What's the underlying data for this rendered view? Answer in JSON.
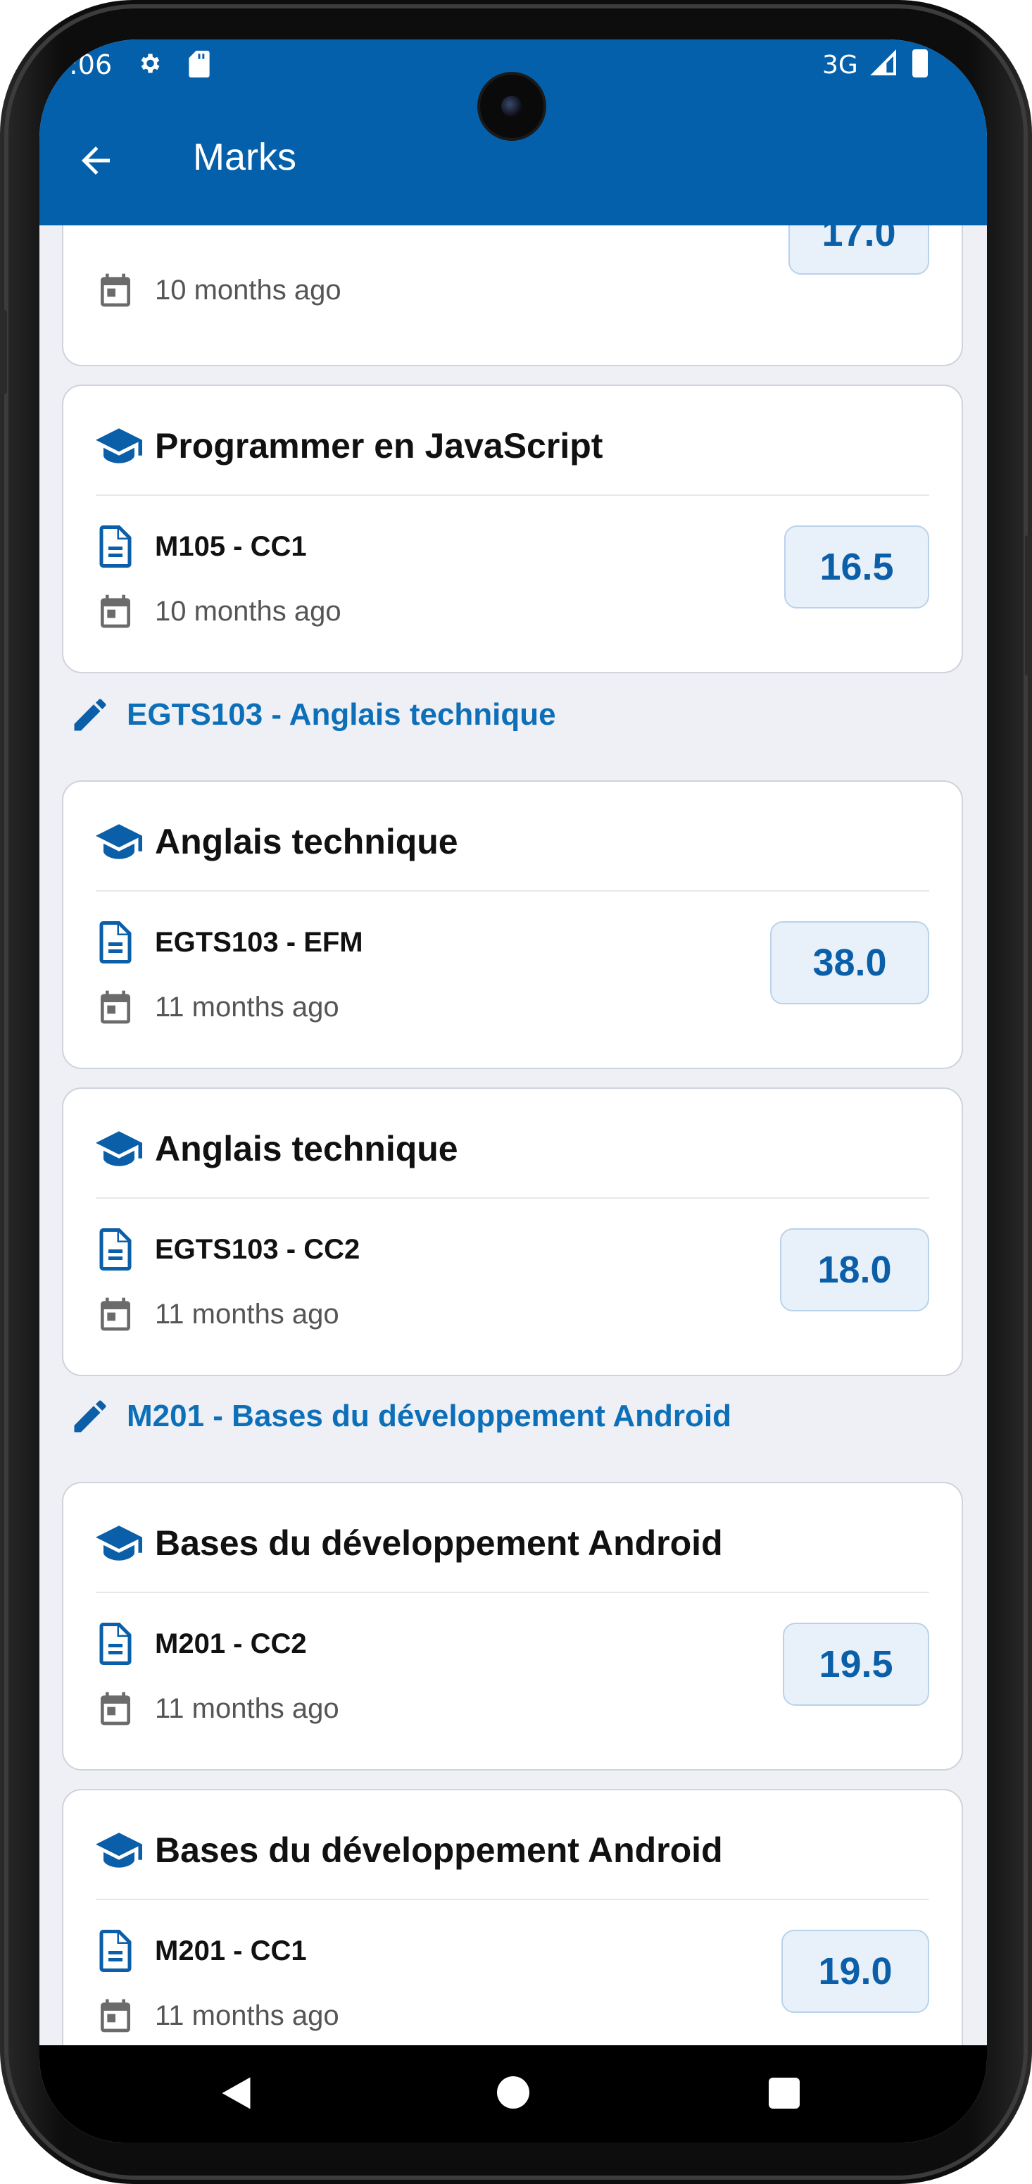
{
  "status_bar": {
    "time": ":06",
    "network": "3G"
  },
  "app_bar": {
    "title": "Marks"
  },
  "colors": {
    "primary": "#0460aa",
    "section_title": "#0d6fb8",
    "mark_text": "#0b5ea8",
    "mark_bg": "#e8f1fa"
  },
  "partial_card": {
    "date": "10 months ago",
    "mark": "17.0"
  },
  "sections": [
    {
      "title": null,
      "cards": [
        {
          "course": "Programmer en JavaScript",
          "exam": "M105 - CC1",
          "date": "10 months ago",
          "mark": "16.5"
        }
      ]
    },
    {
      "title": "EGTS103 - Anglais technique",
      "cards": [
        {
          "course": "Anglais technique",
          "exam": "EGTS103 - EFM",
          "date": "11 months ago",
          "mark": "38.0"
        },
        {
          "course": "Anglais technique",
          "exam": "EGTS103 - CC2",
          "date": "11 months ago",
          "mark": "18.0"
        }
      ]
    },
    {
      "title": "M201 - Bases du développement Android",
      "cards": [
        {
          "course": "Bases du développement Android",
          "exam": "M201 - CC2",
          "date": "11 months ago",
          "mark": "19.5"
        },
        {
          "course": "Bases du développement Android",
          "exam": "M201 - CC1",
          "date": "11 months ago",
          "mark": "19.0"
        }
      ]
    }
  ],
  "icons": {
    "course": "school-cap-icon",
    "exam": "document-icon",
    "date": "calendar-icon",
    "section": "pencil-icon",
    "back": "arrow-back-icon",
    "status_left": [
      "gear-icon",
      "sd-card-icon"
    ],
    "status_right": [
      "signal-icon",
      "battery-icon"
    ],
    "nav": [
      "nav-back-icon",
      "nav-home-icon",
      "nav-recent-icon"
    ]
  }
}
